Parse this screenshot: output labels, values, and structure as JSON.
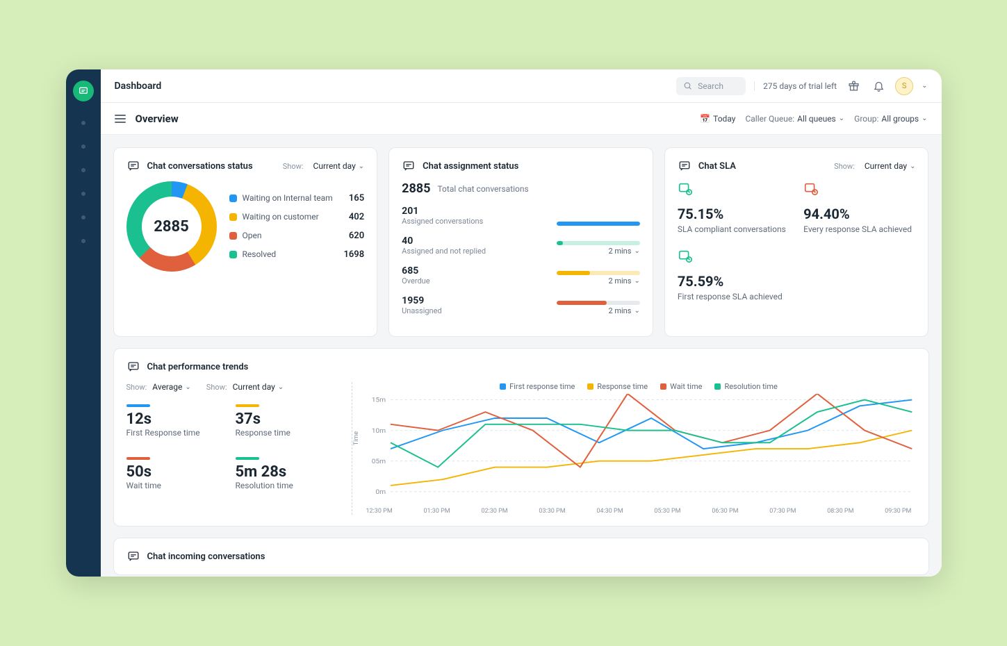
{
  "header": {
    "title": "Dashboard",
    "search_placeholder": "Search",
    "trial": "275 days of trial left",
    "avatar_initial": "S"
  },
  "subheader": {
    "overview": "Overview",
    "today": "Today",
    "queue_label": "Caller Queue:",
    "queue_value": "All queues",
    "group_label": "Group:",
    "group_value": "All groups"
  },
  "colors": {
    "blue": "#2196f3",
    "yellow": "#f4b400",
    "red": "#e0603d",
    "green": "#1ac08f"
  },
  "status_card": {
    "title": "Chat conversations status",
    "show_label": "Show:",
    "show_value": "Current day",
    "total": "2885",
    "items": [
      {
        "label": "Waiting on Internal team",
        "value": "165",
        "color": "blue"
      },
      {
        "label": "Waiting on customer",
        "value": "402",
        "color": "yellow"
      },
      {
        "label": "Open",
        "value": "620",
        "color": "red"
      },
      {
        "label": "Resolved",
        "value": "1698",
        "color": "green"
      }
    ]
  },
  "assignment_card": {
    "title": "Chat assignment status",
    "total": "2885",
    "total_label": "Total chat conversations",
    "rows": [
      {
        "value": "201",
        "label": "Assigned conversations",
        "pct": 100,
        "color": "blue",
        "bg": "blue",
        "time": ""
      },
      {
        "value": "40",
        "label": "Assigned and not replied",
        "pct": 8,
        "color": "green",
        "bg": "green",
        "time": "2 mins"
      },
      {
        "value": "685",
        "label": "Overdue",
        "pct": 40,
        "color": "yellow",
        "bg": "yellow",
        "time": "2 mins"
      },
      {
        "value": "1959",
        "label": "Unassigned",
        "pct": 60,
        "color": "red",
        "bg": "red",
        "time": "2 mins"
      }
    ]
  },
  "sla_card": {
    "title": "Chat SLA",
    "show_label": "Show:",
    "show_value": "Current day",
    "items": [
      {
        "value": "75.15%",
        "label": "SLA compliant conversations",
        "icon_color": "#1ac08f"
      },
      {
        "value": "94.40%",
        "label": "Every response SLA achieved",
        "icon_color": "#e0603d"
      },
      {
        "value": "75.59%",
        "label": "First response SLA achieved",
        "icon_color": "#1ac08f"
      }
    ]
  },
  "perf_card": {
    "title": "Chat performance trends",
    "show1_label": "Show:",
    "show1_value": "Average",
    "show2_label": "Show:",
    "show2_value": "Current day",
    "metrics": [
      {
        "value": "12s",
        "label": "First Response time",
        "color": "blue"
      },
      {
        "value": "37s",
        "label": "Response time",
        "color": "yellow"
      },
      {
        "value": "50s",
        "label": "Wait time",
        "color": "red"
      },
      {
        "value": "5m 28s",
        "label": "Resolution time",
        "color": "green"
      }
    ],
    "legend": [
      {
        "label": "First response time",
        "color": "blue"
      },
      {
        "label": "Response time",
        "color": "yellow"
      },
      {
        "label": "Wait time",
        "color": "red"
      },
      {
        "label": "Resolution time",
        "color": "green"
      }
    ],
    "yaxis": "Time"
  },
  "incoming_card": {
    "title": "Chat incoming conversations"
  },
  "chart_data": {
    "type": "line",
    "ylabel": "Time",
    "yticks": [
      "0m",
      "05m",
      "10m",
      "15m"
    ],
    "ylim": [
      0,
      15
    ],
    "categories": [
      "12:30 PM",
      "01:30 PM",
      "02:30 PM",
      "03:30 PM",
      "04:30 PM",
      "05:30 PM",
      "06:30 PM",
      "07:30 PM",
      "08:30 PM",
      "09:30 PM"
    ],
    "series": [
      {
        "name": "First response time",
        "color": "#2196f3",
        "values": [
          7,
          10,
          12,
          12,
          8,
          12,
          7,
          8,
          10,
          14,
          15
        ]
      },
      {
        "name": "Response time",
        "color": "#f4b400",
        "values": [
          1,
          2,
          4,
          4,
          5,
          5,
          6,
          7,
          7,
          8,
          10
        ]
      },
      {
        "name": "Wait time",
        "color": "#e0603d",
        "values": [
          11,
          10,
          13,
          10,
          4,
          16,
          10,
          8,
          10,
          16,
          10,
          7
        ]
      },
      {
        "name": "Resolution time",
        "color": "#1ac08f",
        "values": [
          8,
          4,
          11,
          11,
          11,
          10,
          10,
          8,
          8,
          13,
          15,
          13
        ]
      }
    ]
  }
}
